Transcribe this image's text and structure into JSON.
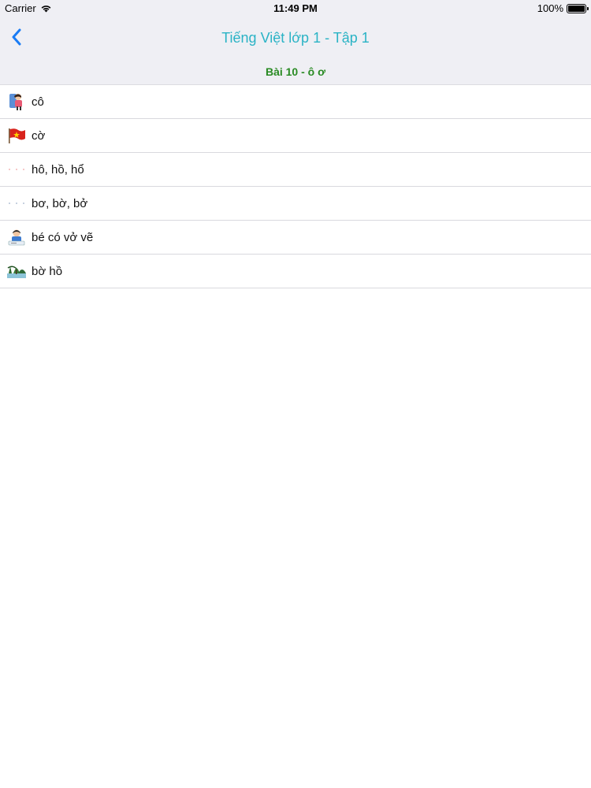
{
  "status": {
    "carrier": "Carrier",
    "time": "11:49 PM",
    "battery": "100%",
    "battery_level": 1.0,
    "wifi_icon": "wifi-icon"
  },
  "nav": {
    "title": "Tiếng Việt lớp 1 - Tập 1",
    "back_icon": "chevron-left-icon"
  },
  "section": {
    "title": "Bài 10 - ô ơ"
  },
  "items": [
    {
      "label": "cô",
      "icon": "teacher-picture-icon"
    },
    {
      "label": "cờ",
      "icon": "flag-picture-icon"
    },
    {
      "label": "hô, hồ, hổ",
      "icon": "dots-placeholder-icon"
    },
    {
      "label": "bơ, bờ, bở",
      "icon": "dots-placeholder-icon"
    },
    {
      "label": "bé có vở vẽ",
      "icon": "child-drawing-picture-icon"
    },
    {
      "label": "bờ hồ",
      "icon": "lake-shore-picture-icon"
    }
  ],
  "colors": {
    "accent": "#2ab3c5",
    "back": "#1a7cf5",
    "section_text": "#2a8b24",
    "bar_bg": "#efeff4"
  }
}
